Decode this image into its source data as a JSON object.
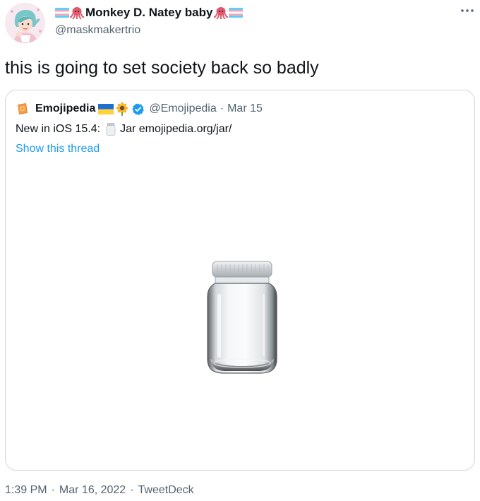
{
  "author": {
    "display_name": "Monkey D. Natey baby",
    "handle": "@maskmakertrio",
    "name_emoji": [
      "trans-flag",
      "octopus",
      "octopus",
      "trans-flag"
    ]
  },
  "tweet": {
    "text": "this is going to set society back so badly"
  },
  "quoted": {
    "display_name": "Emojipedia",
    "name_emoji": [
      "ukraine-flag",
      "sunflower",
      "verified-badge"
    ],
    "handle": "@Emojipedia",
    "separator": "·",
    "date": "Mar 15",
    "body_prefix": "New in iOS 15.4:",
    "body_suffix": "Jar emojipedia.org/jar/",
    "show_thread": "Show this thread"
  },
  "footer": {
    "time": "1:39 PM",
    "separator": "·",
    "date": "Mar 16, 2022",
    "source": "TweetDeck"
  },
  "colors": {
    "link": "#1d9bf0",
    "muted": "#536471",
    "border": "#cfd9de"
  }
}
